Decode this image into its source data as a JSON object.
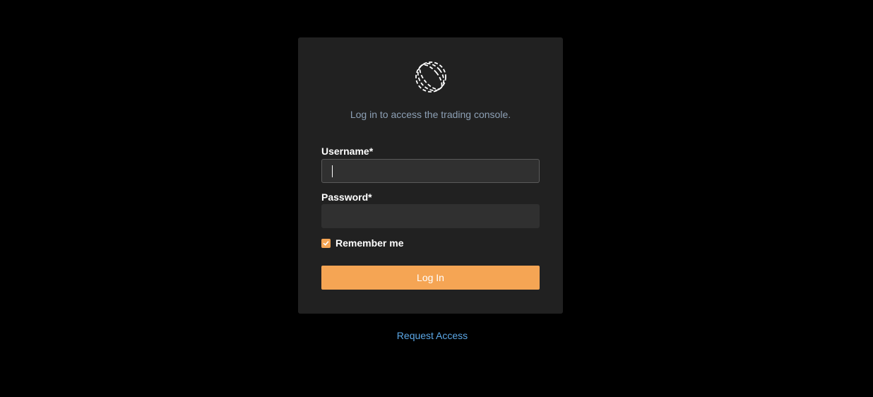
{
  "login": {
    "subtitle": "Log in to access the trading console.",
    "username_label": "Username*",
    "username_value": "",
    "password_label": "Password*",
    "password_value": "",
    "remember_label": "Remember me",
    "remember_checked": true,
    "submit_label": "Log In",
    "request_access_label": "Request Access"
  },
  "icons": {
    "logo": "dashed-ring-logo-icon",
    "checkbox": "check-icon"
  },
  "colors": {
    "background": "#000000",
    "card": "#212121",
    "accent": "#f5a554",
    "subtitle_text": "#8da0b5",
    "link": "#5ba7e6"
  }
}
